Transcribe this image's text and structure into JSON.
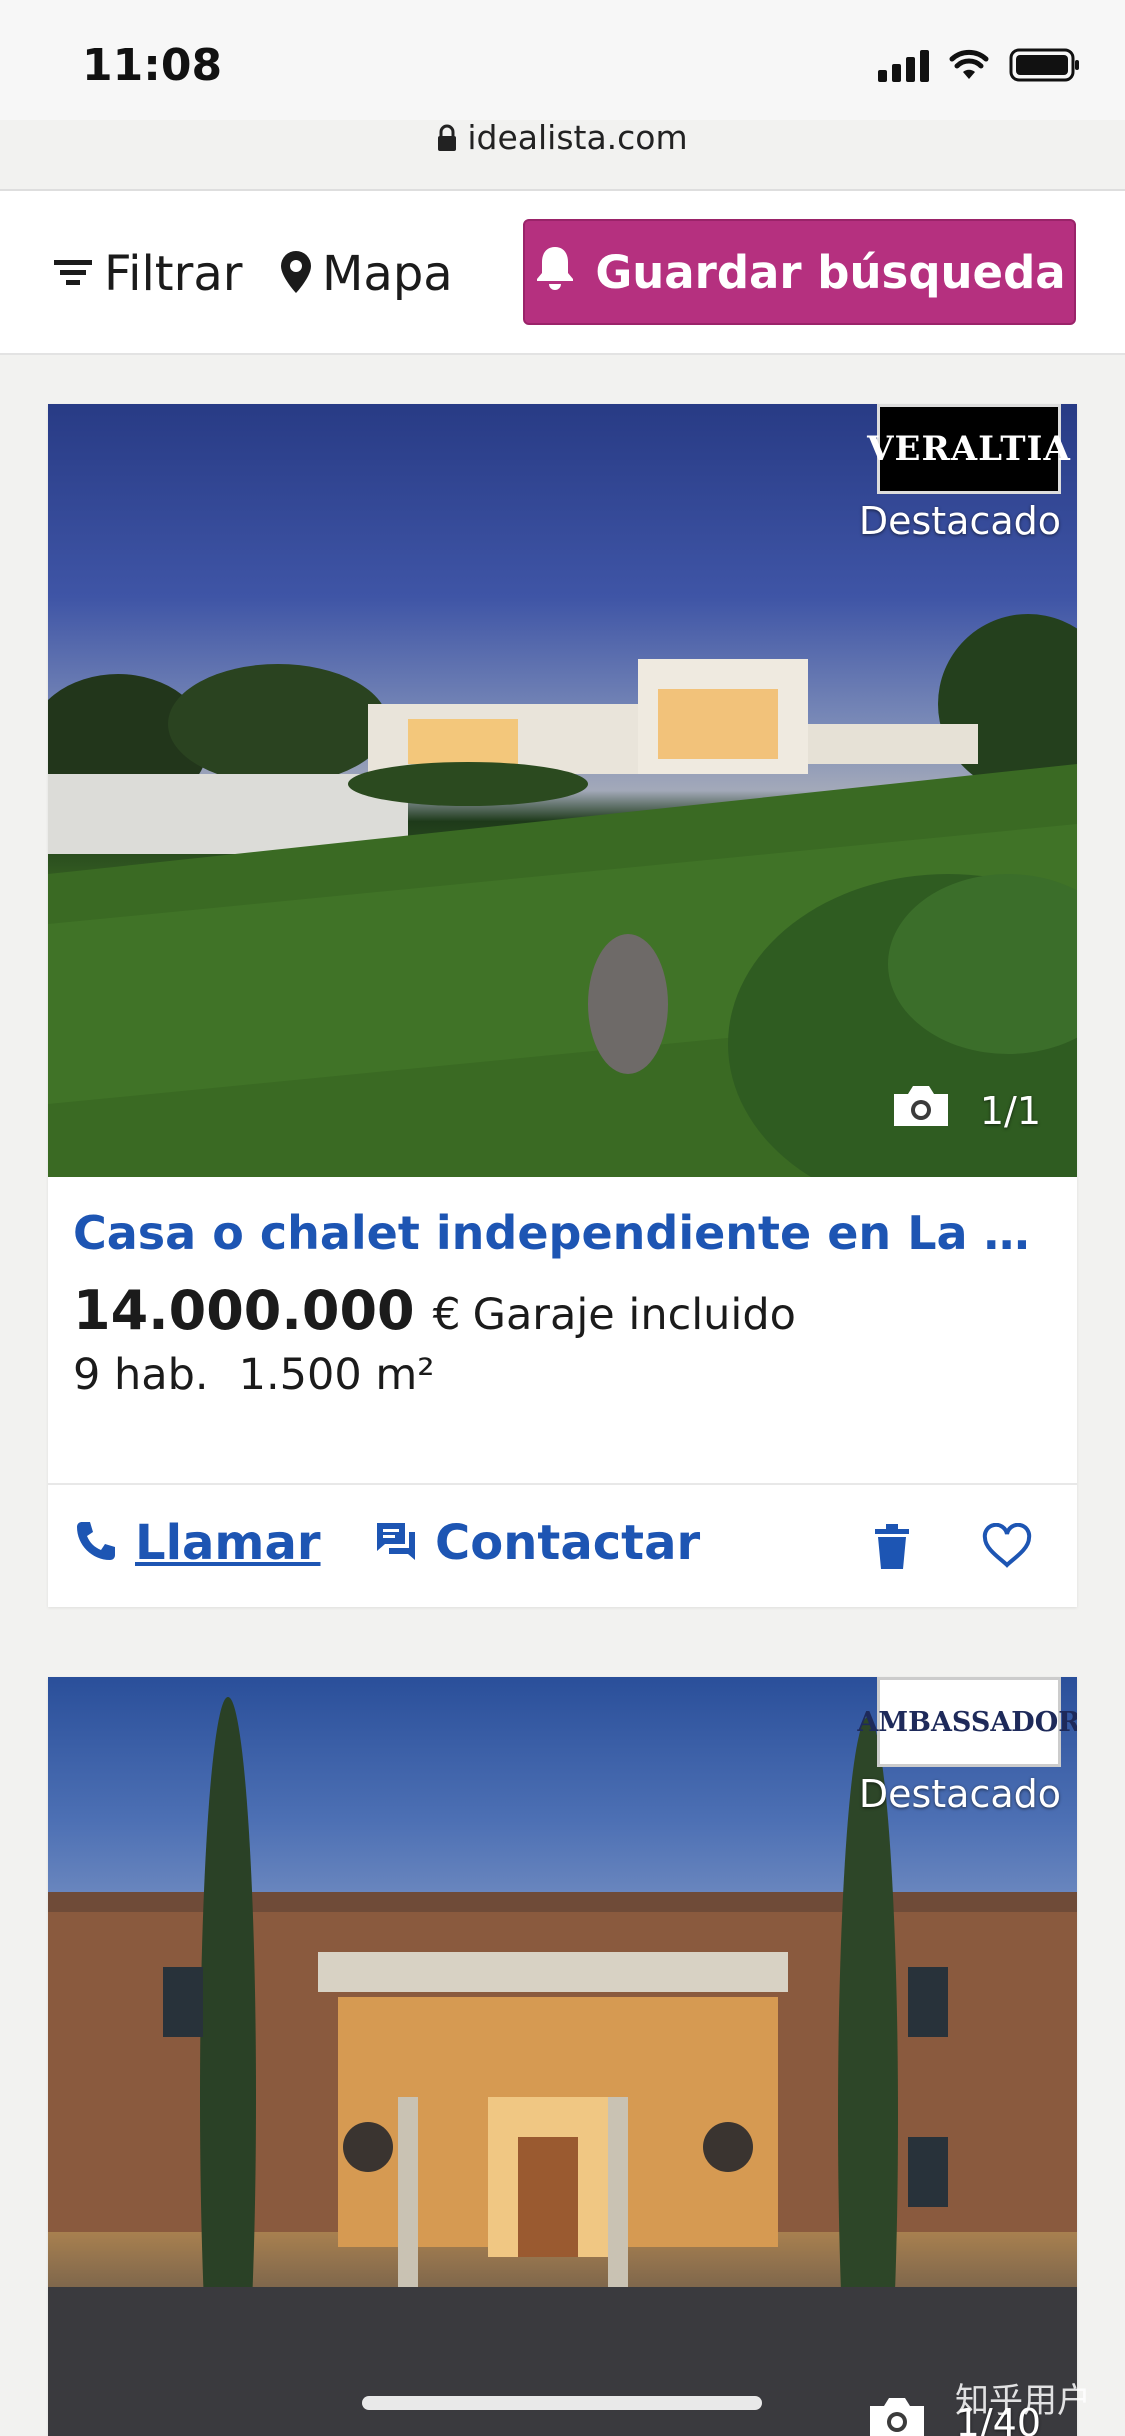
{
  "status_bar": {
    "time": "11:08",
    "signal_icon": "signal-bars-icon",
    "wifi_icon": "wifi-icon",
    "battery_icon": "battery-icon"
  },
  "browser": {
    "url": "idealista.com",
    "lock_icon": "lock-icon"
  },
  "toolbar": {
    "filter_label": "Filtrar",
    "filter_icon": "filter-lines-icon",
    "map_label": "Mapa",
    "map_icon": "map-pin-icon",
    "save_search_label": "Guardar búsqueda",
    "save_search_icon": "bell-icon",
    "save_search_color": "#b5307f"
  },
  "listings": [
    {
      "agency_logo_text": "VERALTIA",
      "featured_label": "Destacado",
      "photo_counter": "1/1",
      "photo_icon": "camera-icon",
      "title": "Casa o chalet independiente en La Mor...",
      "price": "14.000.000",
      "currency": "€",
      "parking": "Garaje incluido",
      "rooms": "9 hab.",
      "area": "1.500 m²",
      "call_label": "Llamar",
      "contact_label": "Contactar",
      "accent_color": "#1d55b3"
    },
    {
      "agency_logo_text": "AMBASSADOR",
      "featured_label": "Destacado",
      "photo_counter": "1/40",
      "photo_icon": "camera-icon"
    }
  ],
  "watermark": "知乎用户"
}
